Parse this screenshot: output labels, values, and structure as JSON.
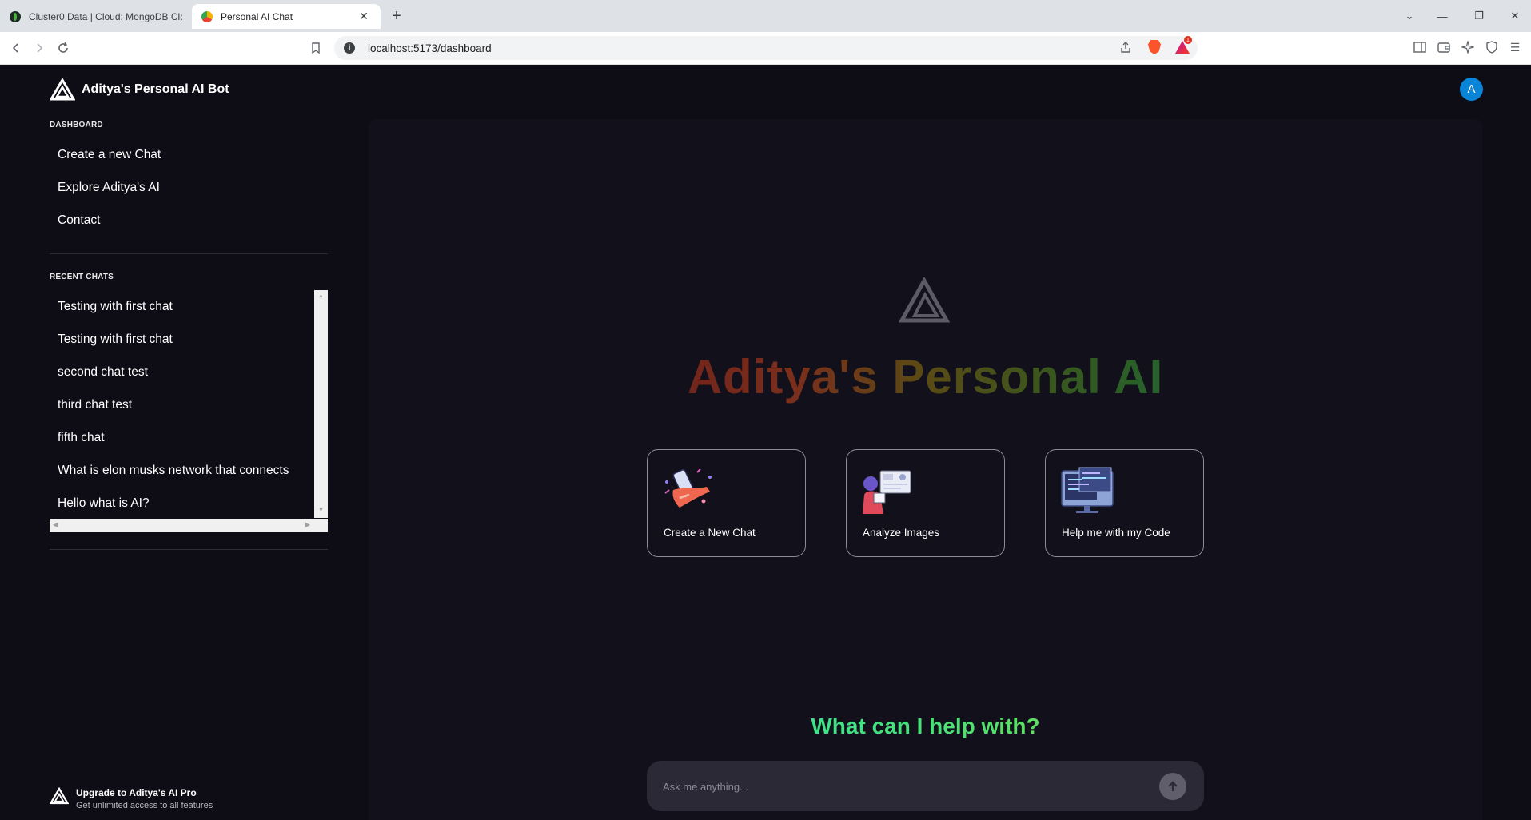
{
  "browser": {
    "tabs": [
      {
        "title": "Cluster0 Data | Cloud: MongoDB Cloud",
        "active": false
      },
      {
        "title": "Personal AI Chat",
        "active": true
      }
    ],
    "url": "localhost:5173/dashboard",
    "rewards_badge": "1"
  },
  "app": {
    "brand": "Aditya's Personal AI Bot",
    "avatar_initial": "A",
    "dashboard_title": "DASHBOARD",
    "nav": [
      "Create a new Chat",
      "Explore Aditya's AI",
      "Contact"
    ],
    "recent_title": "RECENT CHATS",
    "recent_chats": [
      "Testing with first chat",
      "Testing with first chat",
      "second chat test",
      "third chat test",
      "fifth chat",
      "What is elon musks network that connects",
      "Hello what is AI?"
    ],
    "upgrade": {
      "title": "Upgrade to Aditya's AI Pro",
      "subtitle": "Get unlimited access to all features"
    },
    "hero_title": "Aditya's Personal AI",
    "cards": [
      "Create a New Chat",
      "Analyze Images",
      "Help me with my Code"
    ],
    "help_title": "What can I help with?",
    "ask_placeholder": "Ask me anything..."
  },
  "colors": {
    "background": "#0e0c15",
    "panel": "#12101b",
    "avatar": "#0a84d6",
    "input_bar": "#2c2937"
  }
}
